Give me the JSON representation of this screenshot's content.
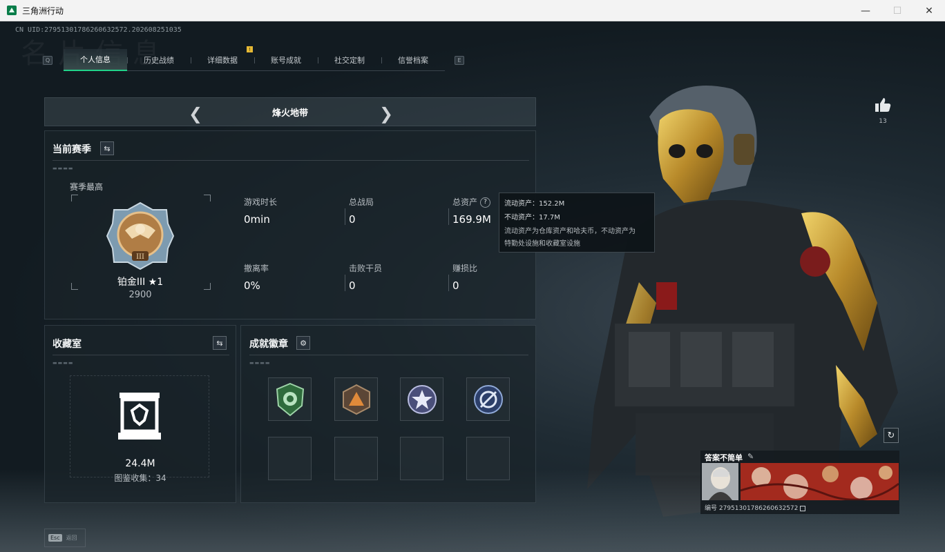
{
  "window": {
    "title": "三角洲行动",
    "minimize": "—",
    "maximize": "☐",
    "close": "✕"
  },
  "uid_line": "CN UID:279513017862606325​72.202608251035",
  "watermark": "名片信息",
  "tabs": {
    "left_key": "Q",
    "right_key": "E",
    "items": [
      {
        "label": "个人信息"
      },
      {
        "label": "历史战绩"
      },
      {
        "label": "详细数据"
      },
      {
        "label": "账号成就"
      },
      {
        "label": "社交定制"
      },
      {
        "label": "信誉档案"
      }
    ],
    "badge": "!"
  },
  "mode": {
    "title": "烽火地带"
  },
  "season": {
    "title": "当前赛季",
    "best_label": "赛季最高",
    "rank_name": "铂金III ★1",
    "rank_score": "2900",
    "stats": [
      {
        "label": "游戏时长",
        "value": "0min"
      },
      {
        "label": "总战局",
        "value": "0"
      },
      {
        "label": "总资产",
        "value": "169.9M"
      },
      {
        "label": "撤离率",
        "value": "0%"
      },
      {
        "label": "击败干员",
        "value": "0"
      },
      {
        "label": "赚损比",
        "value": "0"
      }
    ],
    "help": "?"
  },
  "tooltip": {
    "liquid": "流动资产：152.2M",
    "fixed": "不动资产：17.7M",
    "desc1": "流动资产为仓库资产和哈夫币，不动资产为",
    "desc2": "特勤处设施和收藏室设施"
  },
  "collection": {
    "title": "收藏室",
    "value": "24.4M",
    "sub": "图鉴收集：34"
  },
  "achievements": {
    "title": "成就徽章"
  },
  "profile": {
    "likes": "13",
    "name": "答案不简单",
    "id_line": "编号 279513017862606325​72"
  },
  "footer": {
    "esc_key": "Esc",
    "esc_label": "返回"
  },
  "colors": {
    "accent": "#21d38a",
    "badge": "#e6b934"
  }
}
